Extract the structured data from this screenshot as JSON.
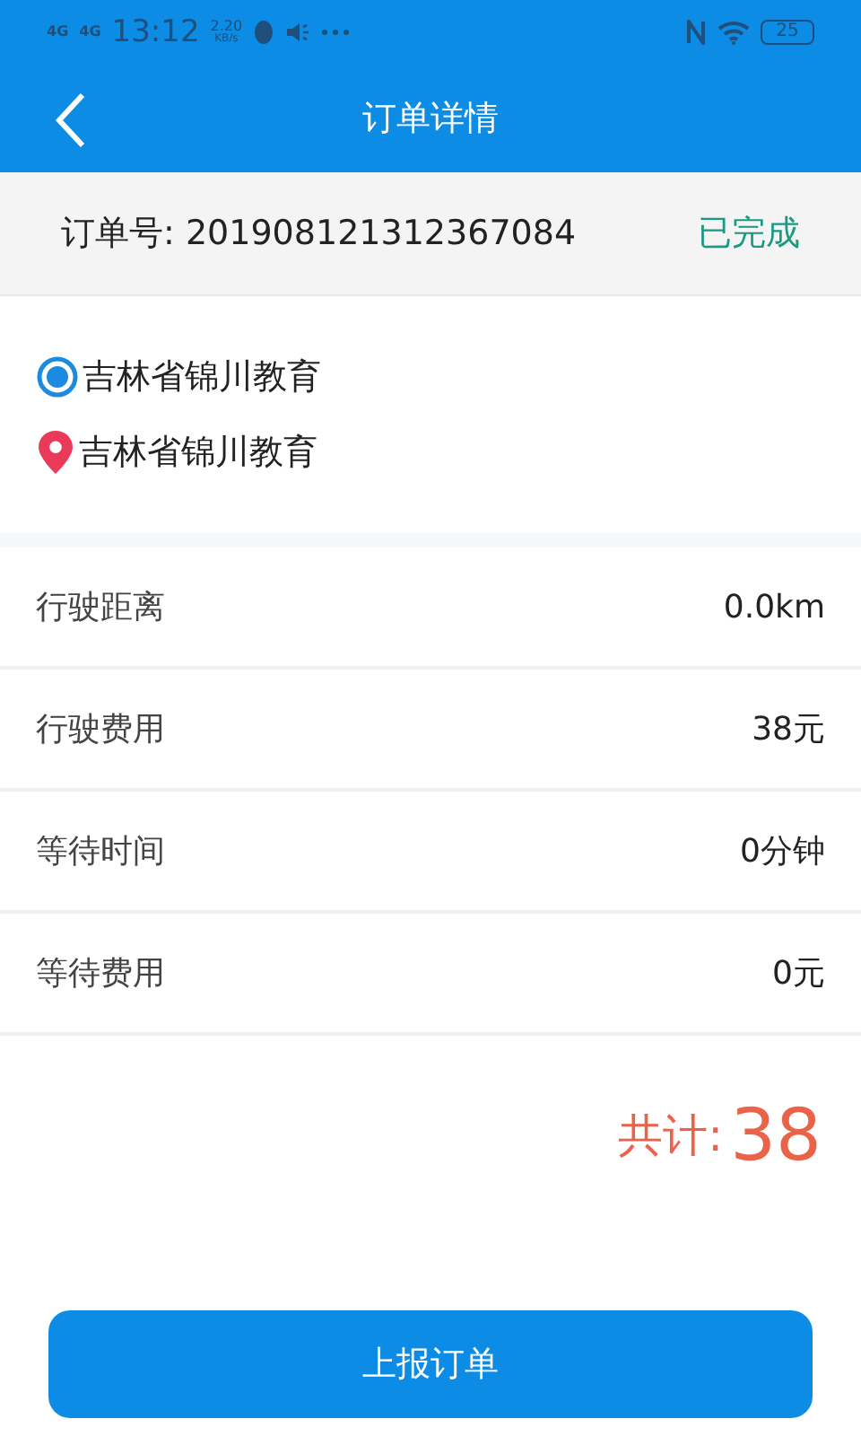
{
  "status_bar": {
    "network_1": "4G",
    "network_2": "4G",
    "time": "13:12",
    "speed_value": "2.20",
    "speed_unit": "KB/s",
    "battery": "25"
  },
  "header": {
    "title": "订单详情"
  },
  "order": {
    "label": "订单号:",
    "number": "201908121312367084",
    "status": "已完成"
  },
  "addresses": [
    {
      "kind": "start",
      "text": "吉林省锦川教育"
    },
    {
      "kind": "end",
      "text": "吉林省锦川教育"
    }
  ],
  "details": [
    {
      "label": "行驶距离",
      "value": "0.0km"
    },
    {
      "label": "行驶费用",
      "value": "38元"
    },
    {
      "label": "等待时间",
      "value": "0分钟"
    },
    {
      "label": "等待费用",
      "value": "0元"
    }
  ],
  "total": {
    "label": "共计:",
    "value": "38"
  },
  "submit_button": "上报订单"
}
